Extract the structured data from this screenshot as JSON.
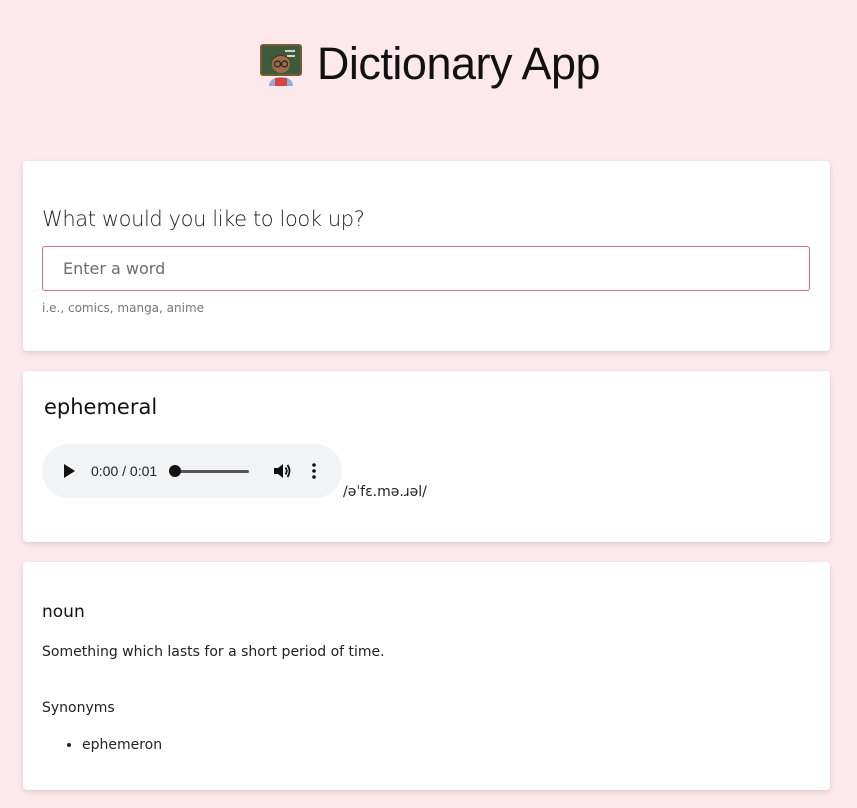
{
  "app": {
    "title": "Dictionary App",
    "icon": "teacher-emoji"
  },
  "search": {
    "label": "What would you like to look up?",
    "placeholder": "Enter a word",
    "value": "",
    "hint": "i.e., comics, manga, anime"
  },
  "word": {
    "title": "ephemeral",
    "phonetic": "/əˈfɛ.mə.ɹəl/",
    "audio": {
      "time": "0:00 / 0:01",
      "progress": 0
    }
  },
  "meaning": {
    "part_of_speech": "noun",
    "definition": "Something which lasts for a short period of time.",
    "synonyms_heading": "Synonyms",
    "synonyms": [
      "ephemeron"
    ]
  },
  "colors": {
    "background": "#fde8ec",
    "input_border": "#d36a9d",
    "player_bg": "#f1f3f4"
  }
}
